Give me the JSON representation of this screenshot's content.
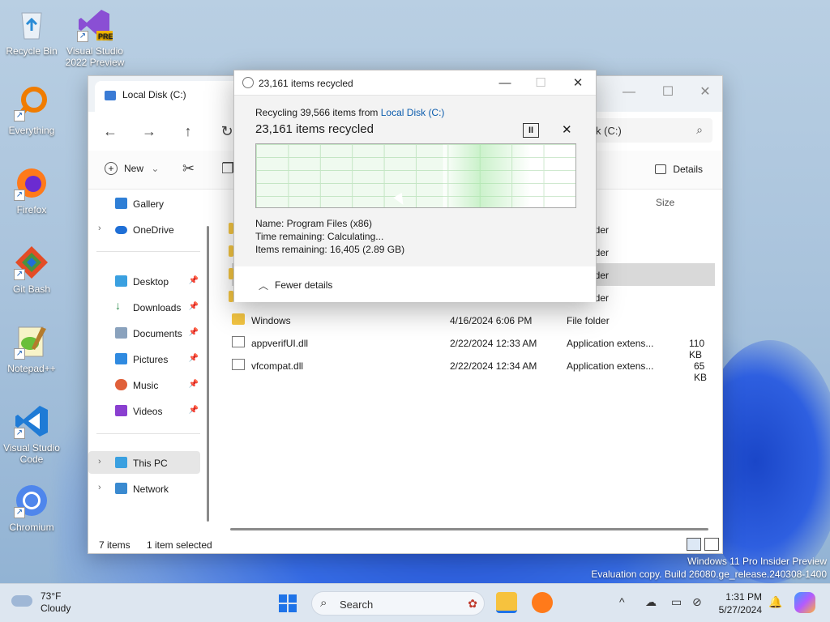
{
  "desktop": {
    "icons": [
      {
        "label": "Recycle Bin"
      },
      {
        "label": "Visual Studio 2022 Preview",
        "badge": "PRE"
      },
      {
        "label": "Everything"
      },
      {
        "label": "Firefox"
      },
      {
        "label": "Git Bash"
      },
      {
        "label": "Notepad++"
      },
      {
        "label": "Visual Studio Code"
      },
      {
        "label": "Chromium"
      }
    ],
    "watermark": {
      "line1": "Windows 11 Pro Insider Preview",
      "line2": "Evaluation copy. Build 26080.ge_release.240308-1400"
    }
  },
  "explorer": {
    "tab_title": "Local Disk (C:)",
    "address_text": "k (C:)",
    "toolbar": {
      "new_label": "New",
      "details_label": "Details"
    },
    "sidebar": {
      "gallery": "Gallery",
      "onedrive": "OneDrive",
      "desktop": "Desktop",
      "downloads": "Downloads",
      "documents": "Documents",
      "pictures": "Pictures",
      "music": "Music",
      "videos": "Videos",
      "this_pc": "This PC",
      "network": "Network"
    },
    "columns": {
      "size": "Size"
    },
    "partial_rows": [
      "lder",
      "lder",
      "lder",
      "lder"
    ],
    "rows": [
      {
        "name": "Windows",
        "date": "4/16/2024 6:06 PM",
        "type": "File folder",
        "size": ""
      },
      {
        "name": "appverifUI.dll",
        "date": "2/22/2024 12:33 AM",
        "type": "Application extens...",
        "size": "110 KB"
      },
      {
        "name": "vfcompat.dll",
        "date": "2/22/2024 12:34 AM",
        "type": "Application extens...",
        "size": "65 KB"
      }
    ],
    "status": {
      "items": "7 items",
      "selected": "1 item selected"
    }
  },
  "dialog": {
    "title": "23,161 items recycled",
    "from_prefix": "Recycling 39,566 items from",
    "from_link": "Local Disk (C:)",
    "heading": "23,161 items recycled",
    "name_line": "Name:  Program Files (x86)",
    "time_line": "Time remaining:  Calculating...",
    "items_line": "Items remaining:  16,405 (2.89 GB)",
    "fewer_details": "Fewer details",
    "progress_fraction": 0.585
  },
  "taskbar": {
    "weather_temp": "73°F",
    "weather_desc": "Cloudy",
    "search_placeholder": "Search",
    "time": "1:31 PM",
    "date": "5/27/2024"
  },
  "colors": {
    "accent": "#1e73e8",
    "link": "#0b5cad",
    "folder": "#f4c542"
  }
}
